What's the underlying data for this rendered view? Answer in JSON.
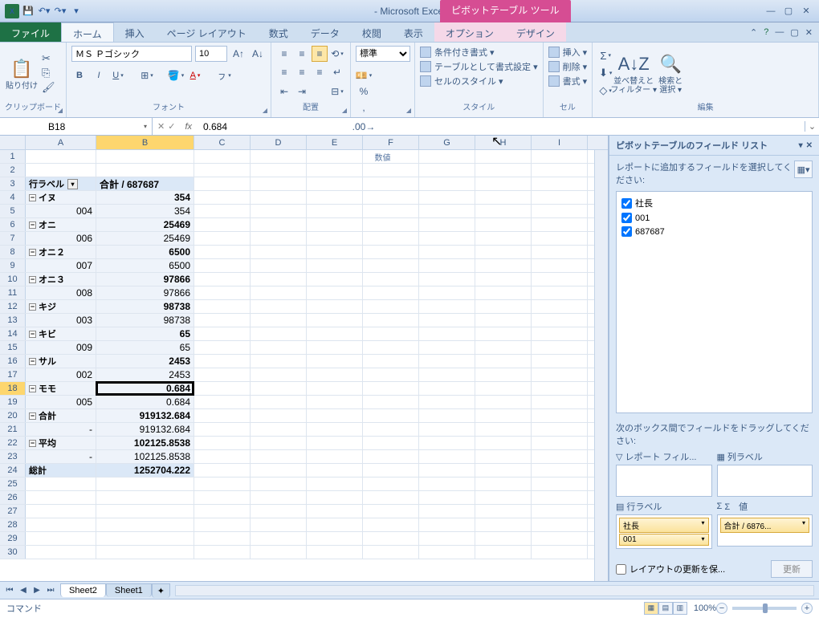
{
  "title_app": "- Microsoft Excel (試用...",
  "title_context": "ピボットテーブル ツール",
  "ribbon_tabs": [
    "ファイル",
    "ホーム",
    "挿入",
    "ページ レイアウト",
    "数式",
    "データ",
    "校閲",
    "表示"
  ],
  "context_tabs": [
    "オプション",
    "デザイン"
  ],
  "ribbon": {
    "clipboard": {
      "paste": "貼り付け",
      "title": "クリップボード"
    },
    "font": {
      "name": "ＭＳ Ｐゴシック",
      "size": "10",
      "title": "フォント"
    },
    "alignment": {
      "title": "配置"
    },
    "number": {
      "format": "標準",
      "title": "数値"
    },
    "styles": {
      "cond": "条件付き書式 ▾",
      "table": "テーブルとして書式設定 ▾",
      "cell": "セルのスタイル ▾",
      "title": "スタイル"
    },
    "cells": {
      "insert": "挿入 ▾",
      "delete": "削除 ▾",
      "format": "書式 ▾",
      "title": "セル"
    },
    "editing": {
      "sort": "並べ替えと\nフィルター ▾",
      "find": "検索と\n選択 ▾",
      "title": "編集"
    }
  },
  "namebox": "B18",
  "formula": "0.684",
  "columns": [
    "A",
    "B",
    "C",
    "D",
    "E",
    "F",
    "G",
    "H",
    "I"
  ],
  "pivot_header_a": "行ラベル",
  "pivot_header_b": "合計 / 687687",
  "rows": [
    {
      "r": 1,
      "a": "",
      "b": ""
    },
    {
      "r": 2,
      "a": "",
      "b": ""
    },
    {
      "r": 3,
      "a": "行ラベル",
      "b": "合計 / 687687",
      "hdr": true
    },
    {
      "r": 4,
      "a": "イヌ",
      "b": "354",
      "exp": true,
      "bold": true
    },
    {
      "r": 5,
      "a": "004",
      "b": "354",
      "indent": true
    },
    {
      "r": 6,
      "a": "オニ",
      "b": "25469",
      "exp": true,
      "bold": true
    },
    {
      "r": 7,
      "a": "006",
      "b": "25469",
      "indent": true
    },
    {
      "r": 8,
      "a": "オニ２",
      "b": "6500",
      "exp": true,
      "bold": true
    },
    {
      "r": 9,
      "a": "007",
      "b": "6500",
      "indent": true
    },
    {
      "r": 10,
      "a": "オニ３",
      "b": "97866",
      "exp": true,
      "bold": true
    },
    {
      "r": 11,
      "a": "008",
      "b": "97866",
      "indent": true
    },
    {
      "r": 12,
      "a": "キジ",
      "b": "98738",
      "exp": true,
      "bold": true
    },
    {
      "r": 13,
      "a": "003",
      "b": "98738",
      "indent": true
    },
    {
      "r": 14,
      "a": "キビ",
      "b": "65",
      "exp": true,
      "bold": true
    },
    {
      "r": 15,
      "a": "009",
      "b": "65",
      "indent": true
    },
    {
      "r": 16,
      "a": "サル",
      "b": "2453",
      "exp": true,
      "bold": true
    },
    {
      "r": 17,
      "a": "002",
      "b": "2453",
      "indent": true
    },
    {
      "r": 18,
      "a": "モモ",
      "b": "0.684",
      "exp": true,
      "bold": true,
      "active": true
    },
    {
      "r": 19,
      "a": "005",
      "b": "0.684",
      "indent": true
    },
    {
      "r": 20,
      "a": "合計",
      "b": "919132.684",
      "exp": true,
      "bold": true
    },
    {
      "r": 21,
      "a": "-",
      "b": "919132.684",
      "indent": true
    },
    {
      "r": 22,
      "a": "平均",
      "b": "102125.8538",
      "exp": true,
      "bold": true
    },
    {
      "r": 23,
      "a": "-",
      "b": "102125.8538",
      "indent": true
    },
    {
      "r": 24,
      "a": "総計",
      "b": "1252704.222",
      "total": true
    },
    {
      "r": 25,
      "a": "",
      "b": ""
    },
    {
      "r": 26,
      "a": "",
      "b": ""
    },
    {
      "r": 27,
      "a": "",
      "b": ""
    },
    {
      "r": 28,
      "a": "",
      "b": ""
    },
    {
      "r": 29,
      "a": "",
      "b": ""
    },
    {
      "r": 30,
      "a": "",
      "b": ""
    }
  ],
  "task_pane": {
    "title": "ピボットテーブルのフィールド リスト",
    "desc": "レポートに追加するフィールドを選択してください:",
    "fields": [
      "社長",
      "001",
      "687687"
    ],
    "drag_label": "次のボックス間でフィールドをドラッグしてください:",
    "areas": {
      "report_filter": "レポート フィル...",
      "col_labels": "列ラベル",
      "row_labels": "行ラベル",
      "values": "Σ　値"
    },
    "row_items": [
      "社長",
      "001"
    ],
    "value_items": [
      "合計 / 6876..."
    ],
    "defer": "レイアウトの更新を保...",
    "update": "更新"
  },
  "sheets": [
    "Sheet2",
    "Sheet1"
  ],
  "status": "コマンド",
  "zoom": "100%"
}
